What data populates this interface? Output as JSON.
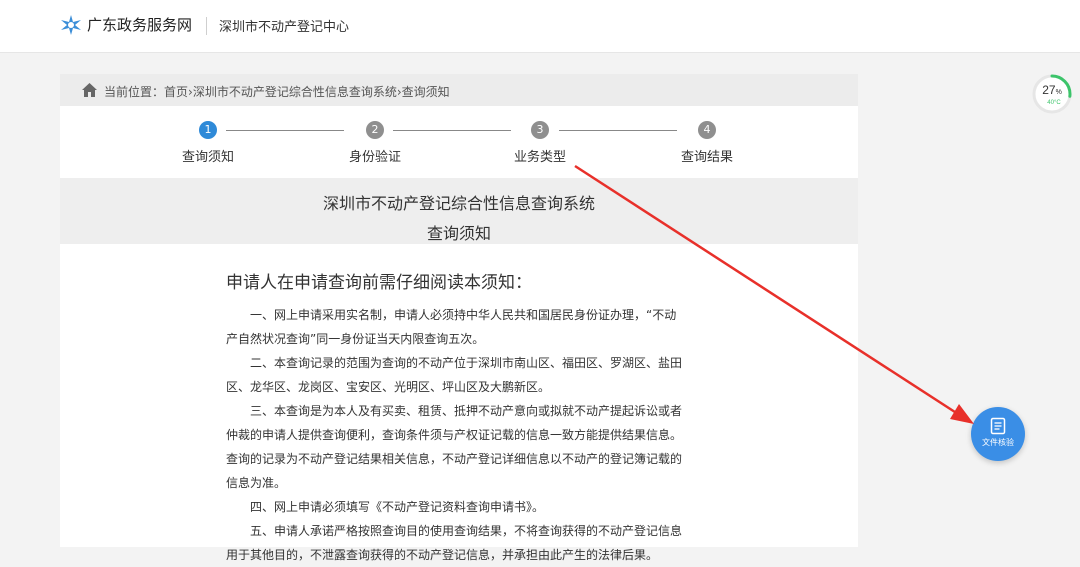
{
  "header": {
    "site_title": "广东政务服务网",
    "center_name": "深圳市不动产登记中心"
  },
  "breadcrumb": {
    "prefix": "当前位置：",
    "items": [
      "首页",
      "深圳市不动产登记综合性信息查询系统",
      "查询须知"
    ],
    "separator": "›"
  },
  "steps": [
    {
      "number": "1",
      "label": "查询须知",
      "state": "active"
    },
    {
      "number": "2",
      "label": "身份验证",
      "state": "todo"
    },
    {
      "number": "3",
      "label": "业务类型",
      "state": "todo"
    },
    {
      "number": "4",
      "label": "查询结果",
      "state": "todo"
    }
  ],
  "page": {
    "system_title": "深圳市不动产登记综合性信息查询系统",
    "notice_title": "查询须知",
    "heading": "申请人在申请查询前需仔细阅读本须知：",
    "paragraphs": [
      "一、网上申请采用实名制，申请人必须持中华人民共和国居民身份证办理，“不动产自然状况查询”同一身份证当天内限查询五次。",
      "二、本查询记录的范围为查询的不动产位于深圳市南山区、福田区、罗湖区、盐田区、龙华区、龙岗区、宝安区、光明区、坪山区及大鹏新区。",
      "三、本查询是为本人及有买卖、租赁、抵押不动产意向或拟就不动产提起诉讼或者仲裁的申请人提供查询便利，查询条件须与产权证记载的信息一致方能提供结果信息。查询的记录为不动产登记结果相关信息，不动产登记详细信息以不动产的登记簿记载的信息为准。",
      "四、网上申请必须填写《不动产登记资料查询申请书》。",
      "五、申请人承诺严格按照查询目的使用查询结果，不将查询获得的不动产登记信息用于其他目的，不泄露查询获得的不动产登记信息，并承担由此产生的法律后果。"
    ]
  },
  "widgets": {
    "gauge_value": "27",
    "gauge_unit": "%",
    "gauge_temp": "40°C",
    "gauge_fraction": 0.27,
    "fab_label": "文件核验"
  },
  "colors": {
    "accent": "#2f8ad8",
    "arrow": "#e8302a",
    "gauge": "#3cc46a"
  }
}
